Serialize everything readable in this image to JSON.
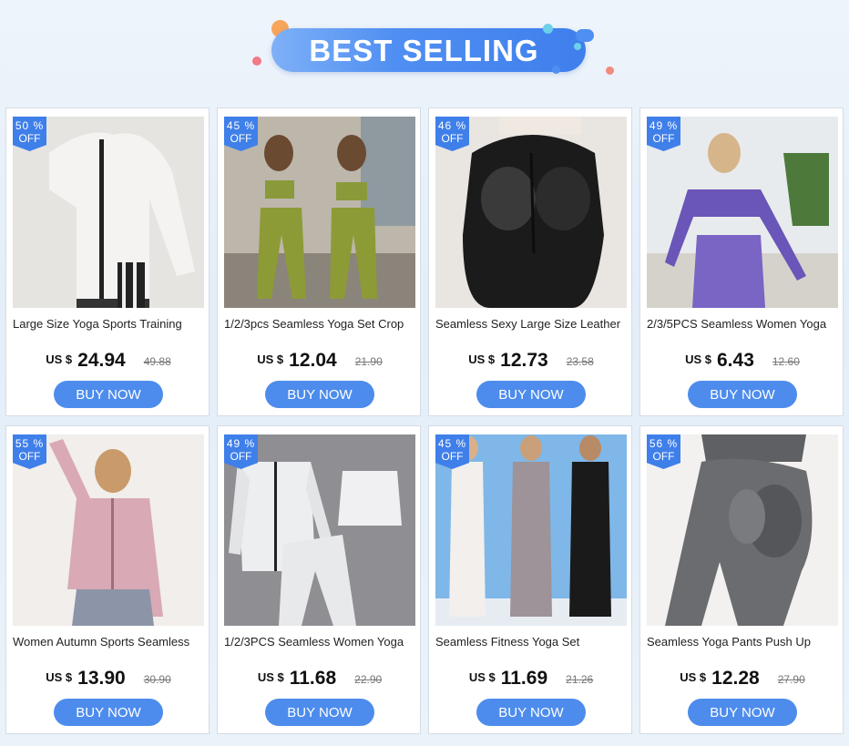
{
  "header": {
    "title": "BEST SELLING"
  },
  "products": [
    {
      "discount": "50 %",
      "off": "OFF",
      "title": "Large Size Yoga Sports Training",
      "currency": "US $",
      "price": "24.94",
      "old_price": "49.88",
      "buy": "BUY NOW",
      "image": "white-zip-jacket-photo"
    },
    {
      "discount": "45 %",
      "off": "OFF",
      "title": "1/2/3pcs Seamless Yoga Set Crop",
      "currency": "US $",
      "price": "12.04",
      "old_price": "21.90",
      "buy": "BUY NOW",
      "image": "green-yoga-set-photo"
    },
    {
      "discount": "46 %",
      "off": "OFF",
      "title": "Seamless Sexy Large Size Leather",
      "currency": "US $",
      "price": "12.73",
      "old_price": "23.58",
      "buy": "BUY NOW",
      "image": "black-leather-leggings-photo"
    },
    {
      "discount": "49 %",
      "off": "OFF",
      "title": "2/3/5PCS Seamless Women Yoga",
      "currency": "US $",
      "price": "6.43",
      "old_price": "12.60",
      "buy": "BUY NOW",
      "image": "purple-yoga-set-photo"
    },
    {
      "discount": "55 %",
      "off": "OFF",
      "title": "Women Autumn Sports Seamless",
      "currency": "US $",
      "price": "13.90",
      "old_price": "30.90",
      "buy": "BUY NOW",
      "image": "pink-zip-jacket-photo"
    },
    {
      "discount": "49 %",
      "off": "OFF",
      "title": "1/2/3PCS Seamless Women Yoga",
      "currency": "US $",
      "price": "11.68",
      "old_price": "22.90",
      "buy": "BUY NOW",
      "image": "white-yoga-set-flatlay-photo"
    },
    {
      "discount": "45 %",
      "off": "OFF",
      "title": "Seamless Fitness Yoga Set",
      "currency": "US $",
      "price": "11.69",
      "old_price": "21.26",
      "buy": "BUY NOW",
      "image": "three-models-yoga-set-photo"
    },
    {
      "discount": "56 %",
      "off": "OFF",
      "title": "Seamless Yoga Pants Push Up",
      "currency": "US $",
      "price": "12.28",
      "old_price": "27.90",
      "buy": "BUY NOW",
      "image": "grey-push-up-leggings-photo"
    }
  ],
  "colors": {
    "accent": "#4d8cec",
    "badge": "#3f7fe9",
    "banner": "#4f8ef2"
  }
}
